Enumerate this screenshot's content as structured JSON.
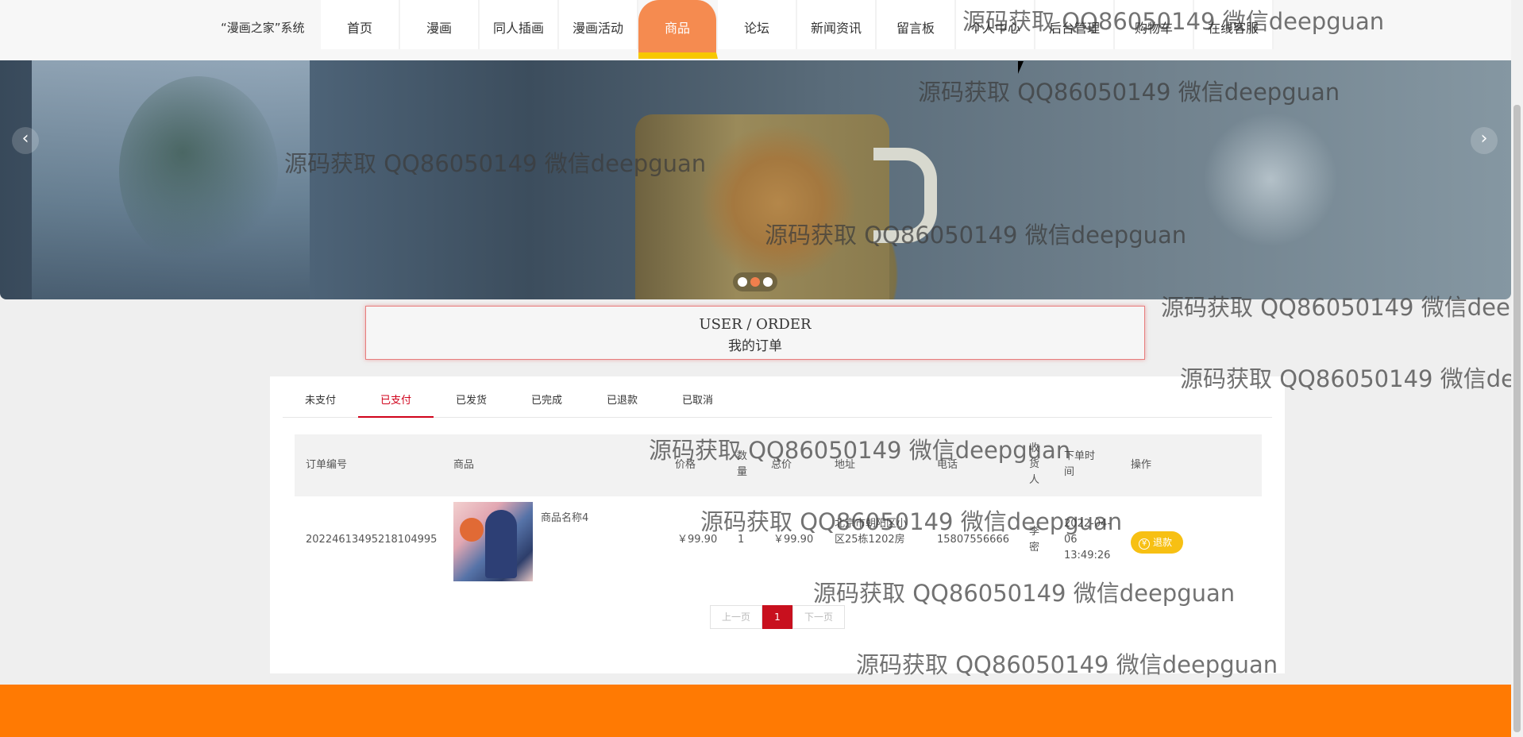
{
  "header": {
    "brand": "“漫画之家”系统",
    "nav": [
      {
        "label": "首页",
        "active": false
      },
      {
        "label": "漫画",
        "active": false
      },
      {
        "label": "同人插画",
        "active": false
      },
      {
        "label": "漫画活动",
        "active": false
      },
      {
        "label": "商品",
        "active": true
      },
      {
        "label": "论坛",
        "active": false
      },
      {
        "label": "新闻资讯",
        "active": false
      },
      {
        "label": "留言板",
        "active": false
      },
      {
        "label": "个人中心",
        "active": false
      },
      {
        "label": "后台管理",
        "active": false
      },
      {
        "label": "购物车",
        "active": false
      },
      {
        "label": "在线客服",
        "active": false
      }
    ]
  },
  "banner": {
    "prev_icon": "‹",
    "next_icon": "›",
    "slides": 3,
    "active_slide": 2
  },
  "section": {
    "title_en": "USER / ORDER",
    "title_cn": "我的订单"
  },
  "orders": {
    "tabs": [
      {
        "label": "未支付",
        "active": false
      },
      {
        "label": "已支付",
        "active": true
      },
      {
        "label": "已发货",
        "active": false
      },
      {
        "label": "已完成",
        "active": false
      },
      {
        "label": "已退款",
        "active": false
      },
      {
        "label": "已取消",
        "active": false
      }
    ],
    "columns": {
      "order_no": "订单编号",
      "product": "商品",
      "price": "价格",
      "qty": "数量",
      "total": "总价",
      "address": "地址",
      "phone": "电话",
      "receiver": "收货人",
      "time": "下单时间",
      "action": "操作"
    },
    "rows": [
      {
        "order_no": "20224613495218104995",
        "product_name": "商品名称4",
        "price": "￥99.90",
        "qty": "1",
        "total": "￥99.90",
        "address": "北京市朝阳区小区25栋1202房",
        "phone": "15807556666",
        "receiver": "李密",
        "time": "2022-04-06 13:49:26",
        "action_label": "退款",
        "action_icon": "¥"
      }
    ],
    "pager": {
      "prev": "上一页",
      "current": "1",
      "next": "下一页"
    }
  },
  "watermark": "源码获取 QQ86050149 微信deepguan",
  "colors": {
    "nav_active": "#f58b50",
    "nav_active_underline": "#f7c800",
    "tab_active": "#d0021b",
    "refund_button": "#f7c013",
    "pager_current": "#c8101e",
    "footer": "#ff7a03"
  }
}
